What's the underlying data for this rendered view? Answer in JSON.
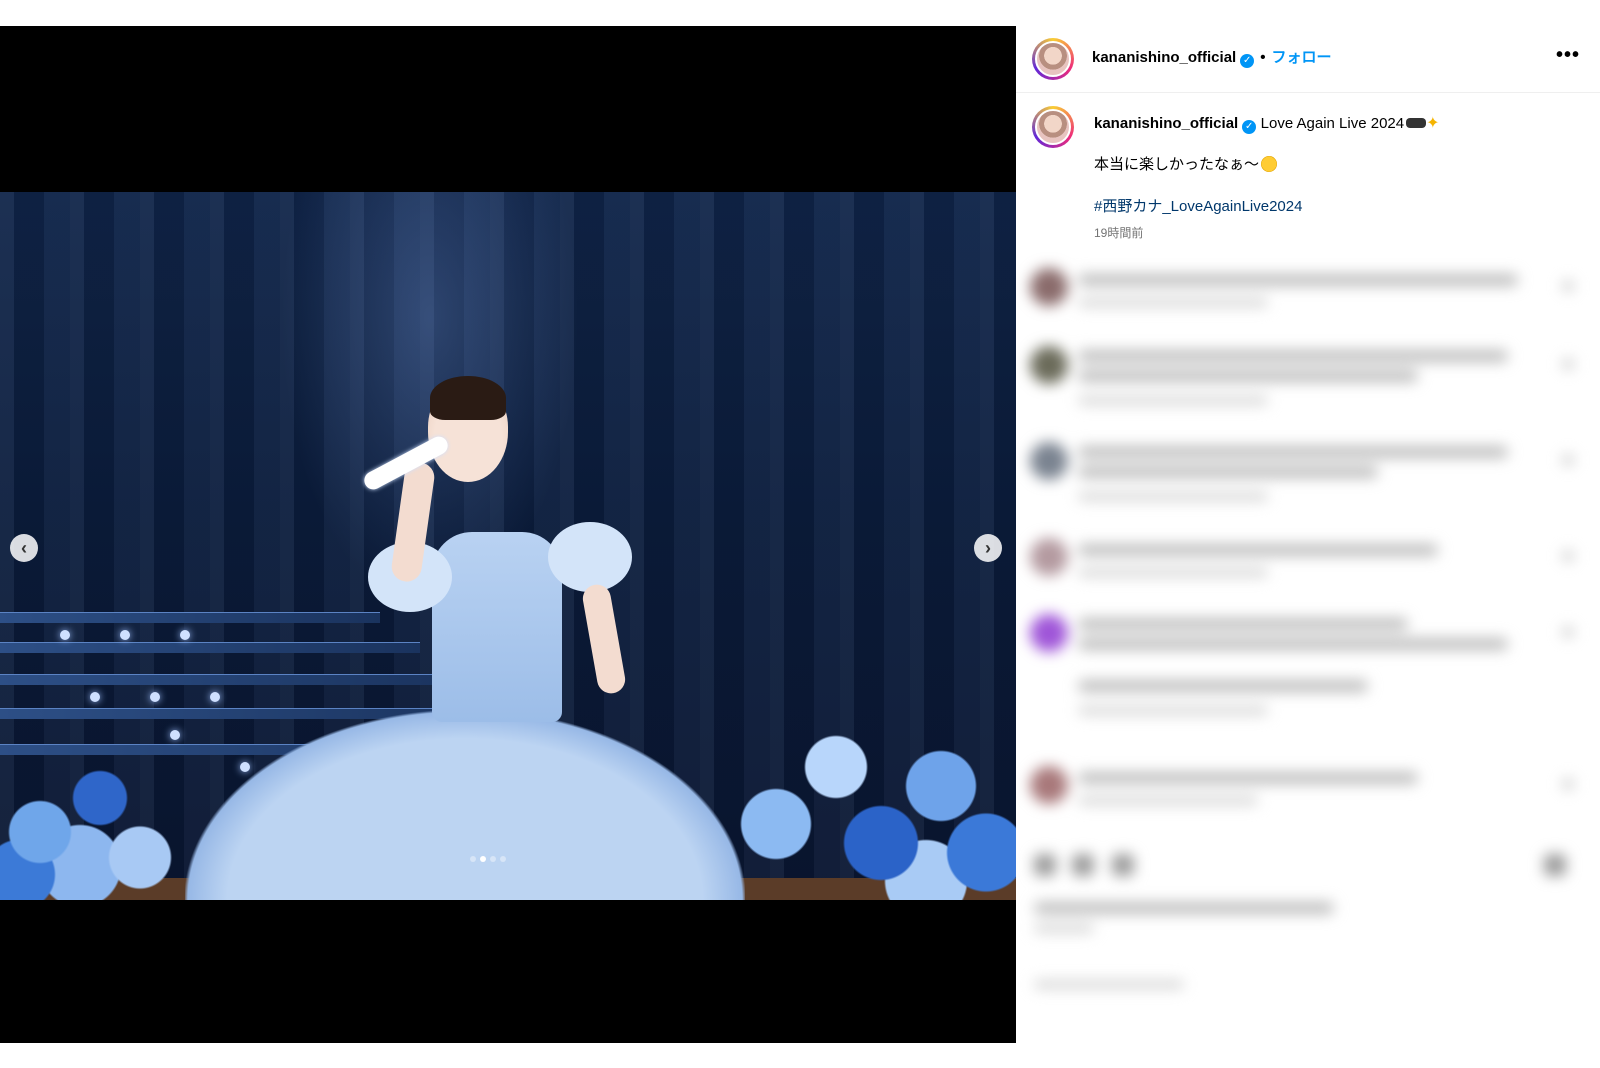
{
  "post": {
    "username": "kananishino_official",
    "follow_label": "フォロー",
    "separator": "•",
    "more_label": "•••",
    "verified_label": "✓",
    "caption": {
      "username": "kananishino_official",
      "title": "Love Again Live 2024",
      "line2": "本当に楽しかったなぁ～",
      "hashtag": "#西野カナ_LoveAgainLive2024",
      "time": "19時間前"
    },
    "nav": {
      "prev_label": "‹",
      "next_label": "›"
    },
    "carousel": {
      "count": 4,
      "active_index": 1
    }
  },
  "colors": {
    "accent": "#0095f6",
    "hashtag": "#00376b",
    "muted": "#737373"
  },
  "icons": [
    "verified-badge-icon",
    "more-options-icon",
    "chevron-left-icon",
    "chevron-right-icon",
    "smiling-face-emoji",
    "sunglasses-emoji",
    "sparkles-emoji",
    "heart-icon"
  ]
}
